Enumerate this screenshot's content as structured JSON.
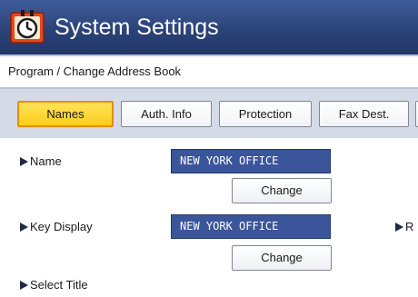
{
  "window": {
    "title": "System Settings",
    "icon": "clock-settings-icon"
  },
  "breadcrumb": "Program / Change Address Book",
  "tabs": [
    {
      "label": "Names",
      "active": true
    },
    {
      "label": "Auth. Info",
      "active": false
    },
    {
      "label": "Protection",
      "active": false
    },
    {
      "label": "Fax Dest.",
      "active": false
    }
  ],
  "fields": {
    "name": {
      "label": "Name",
      "value": "NEW YORK OFFICE",
      "button": "Change"
    },
    "key_display": {
      "label": "Key Display",
      "value": "NEW YORK OFFICE",
      "button": "Change"
    },
    "select_title": {
      "label": "Select Title"
    },
    "right_cutoff": {
      "label": "R"
    }
  },
  "colors": {
    "title_bar": "#2b4379",
    "active_tab": "#fbcd18",
    "active_tab_border": "#ee8a00",
    "value_box": "#3b559b"
  }
}
